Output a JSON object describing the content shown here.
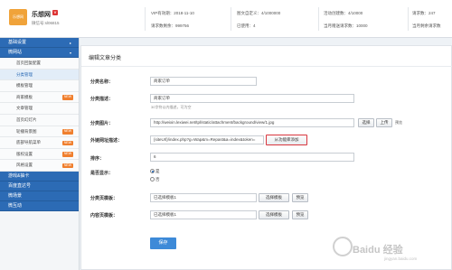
{
  "header": {
    "logo_text": "乐想网",
    "brand_name": "乐想网",
    "brand_badge": "V",
    "wechat_id": "微信号:sl06815",
    "stats": [
      {
        "label": "VIP有效期：2018-11-10"
      },
      {
        "label": "图文自定义：4/1000000"
      },
      {
        "label": "活动创建数：4/10000"
      },
      {
        "label": "请求数：247"
      },
      {
        "label": "请求数剩余：999756"
      },
      {
        "label": "已使用：4"
      },
      {
        "label": "当月赠送请求数：10000"
      },
      {
        "label": "当月剩余请求数"
      }
    ]
  },
  "sidebar": {
    "sections": [
      {
        "label": "基础设置",
        "caret": "▸"
      },
      {
        "label": "微网站",
        "caret": "▾"
      }
    ],
    "items": [
      {
        "label": "首页回复配置",
        "tag": ""
      },
      {
        "label": "分类管理",
        "tag": ""
      },
      {
        "label": "模板管理",
        "tag": ""
      },
      {
        "label": "商家模板",
        "tag": "NEW"
      },
      {
        "label": "文章管理",
        "tag": ""
      },
      {
        "label": "首页幻灯片",
        "tag": ""
      },
      {
        "label": "轮播背景图",
        "tag": "NEW"
      },
      {
        "label": "底部导航菜单",
        "tag": "NEW"
      },
      {
        "label": "版权设置",
        "tag": "NEW"
      },
      {
        "label": "风格设置",
        "tag": "NEW"
      }
    ],
    "bottom_sections": [
      {
        "label": "游戏&抽卡"
      },
      {
        "label": "百度直达号"
      },
      {
        "label": "微场景"
      },
      {
        "label": "微互动"
      }
    ]
  },
  "form": {
    "title": "编辑文章分类",
    "name_label": "分类名称：",
    "name_value": "商家订单",
    "desc_label": "分类描述：",
    "desc_value": "商家订单",
    "desc_hint": "30字符以内描述，可为空",
    "image_label": "分类图片：",
    "image_value": "http://weixin.lexiwei.net/tpl/static/attachment/background/view/1.jpg",
    "select_btn": "选择",
    "upload_btn": "上传",
    "preview_btn": "预览",
    "link_label": "外链网址描述：",
    "link_value": "{siteUrl}/index.php?g=Wap&m=Repast&a=index&token=",
    "link_btn": "从功能库添加",
    "sort_label": "排序：",
    "sort_value": "6",
    "show_label": "是否显示：",
    "show_yes": "是",
    "show_no": "否",
    "cat_tpl_label": "分类页模板：",
    "cat_tpl_value": "已选择模板1",
    "cat_tpl_select": "选择模板",
    "cat_tpl_preview": "预览",
    "content_tpl_label": "内容页模板：",
    "content_tpl_value": "已选择模板1",
    "content_tpl_select": "选择模板",
    "content_tpl_preview": "预览",
    "save_btn": "保存"
  },
  "watermark": {
    "text": "Baidu 经验",
    "sub": "jingyan.baidu.com"
  }
}
